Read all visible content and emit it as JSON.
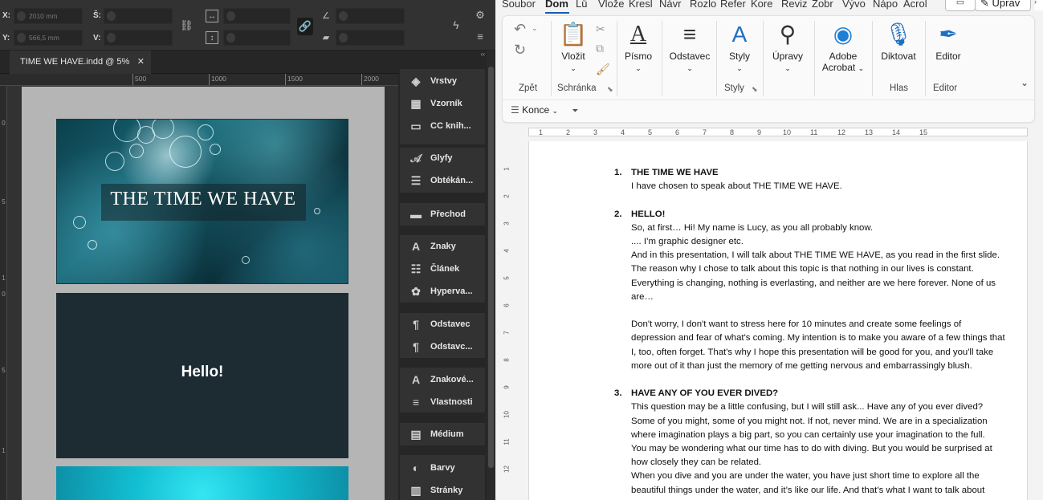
{
  "indesign": {
    "control": {
      "x_label": "X:",
      "x_value": "2010 mm",
      "y_label": "Y:",
      "y_value": "566,5 mm",
      "w_label": "Š:",
      "w_value": "",
      "h_label": "V:",
      "h_value": ""
    },
    "doc_tab": "TIME WE HAVE.indd @ 5%",
    "doc_tab_close": "✕",
    "ruler_labels": [
      "500",
      "1000",
      "1500",
      "2000"
    ],
    "vruler_labels": [
      "0",
      "5",
      "1",
      "0",
      "5",
      "1"
    ],
    "slide1_title": "THE TIME WE HAVE",
    "slide2_title": "Hello!",
    "collapse_glyph": "‹‹",
    "panels": [
      {
        "label": "Vrstvy",
        "icon": "layers-icon",
        "glyph": "◈"
      },
      {
        "label": "Vzorník",
        "icon": "swatches-icon",
        "glyph": "▦"
      },
      {
        "label": "CC knih...",
        "icon": "cc-libraries-icon",
        "glyph": "▭"
      },
      {
        "label": "Glyfy",
        "icon": "glyphs-icon",
        "glyph": "𝒜"
      },
      {
        "label": "Obtékán...",
        "icon": "text-wrap-icon",
        "glyph": "☰"
      },
      {
        "label": "Přechod",
        "icon": "gradient-icon",
        "glyph": "▬"
      },
      {
        "label": "Znaky",
        "icon": "character-icon",
        "glyph": "A"
      },
      {
        "label": "Článek",
        "icon": "article-icon",
        "glyph": "☷"
      },
      {
        "label": "Hyperva...",
        "icon": "hyperlinks-icon",
        "glyph": "✿"
      },
      {
        "label": "Odstavec",
        "icon": "paragraph-icon",
        "glyph": "¶"
      },
      {
        "label": "Odstavc...",
        "icon": "paragraph-styles-icon",
        "glyph": "¶"
      },
      {
        "label": "Znakové...",
        "icon": "character-styles-icon",
        "glyph": "A"
      },
      {
        "label": "Vlastnosti",
        "icon": "properties-icon",
        "glyph": "≡"
      },
      {
        "label": "Médium",
        "icon": "media-icon",
        "glyph": "▤"
      },
      {
        "label": "Barvy",
        "icon": "color-icon",
        "glyph": "◐"
      },
      {
        "label": "Stránky",
        "icon": "pages-icon",
        "glyph": "▥"
      }
    ]
  },
  "word": {
    "tabs": [
      "Soubor",
      "Dom",
      "Lů",
      "Vlože",
      "Kresl",
      "Návr",
      "Rozlo",
      "Refer",
      "Kore",
      "Reviz",
      "Zobr",
      "Vývo",
      "Nápo",
      "Acrol"
    ],
    "share_label": "Úprav",
    "ribbon": {
      "undo_label": "Zpět",
      "paste_label": "Vložit",
      "clipboard_label": "Schránka",
      "font_label": "Písmo",
      "paragraph_label": "Odstavec",
      "styles_label": "Styly",
      "styles_group": "Styly",
      "editing_label": "Úpravy",
      "acrobat_label_1": "Adobe",
      "acrobat_label_2": "Acrobat",
      "dictate_label": "Diktovat",
      "voice_group": "Hlas",
      "editor_label": "Editor",
      "editor_group": "Editor",
      "style_box": "Konce"
    },
    "ruler_labels": [
      "1",
      "2",
      "3",
      "4",
      "5",
      "6",
      "7",
      "8",
      "9",
      "10",
      "11",
      "12",
      "13",
      "14",
      "15"
    ],
    "vruler_labels": [
      "1",
      "2",
      "3",
      "4",
      "5",
      "6",
      "7",
      "8",
      "9",
      "10",
      "11",
      "12"
    ],
    "items": [
      {
        "num": "1.",
        "title": "THE TIME WE HAVE",
        "lines": [
          "I have chosen to speak about THE TIME WE HAVE."
        ]
      },
      {
        "num": "2.",
        "title": "HELLO!",
        "lines": [
          "So, at first… Hi! My name is Lucy, as you all probably know.",
          ".... I’m graphic designer etc.",
          "And in this presentation, I will talk about THE TIME WE HAVE, as you read in the first slide.",
          "The reason why I chose to talk about this topic is that nothing in our lives is constant.",
          "Everything is changing, nothing is everlasting, and neither are we here forever. None of us",
          "are…",
          "",
          "Don't worry, I don't want to stress here for 10 minutes and create some feelings of",
          "depression and fear of what's coming. My intention is to make you aware of a few things that",
          "I, too, often forget. That's why I hope this presentation will be good for you, and you'll take",
          "more out of it than just the memory of me getting nervous and embarrassingly blush."
        ]
      },
      {
        "num": "3.",
        "title": "HAVE ANY OF YOU EVER DIVED?",
        "lines": [
          "This question may be a little confusing, but I will still ask... Have any of you ever dived?",
          "Some of you might, some of you might not. If not, never mind. We are in a specialization",
          "where imagination plays a big part, so you can certainly use your imagination to the full.",
          "You may be wondering what our time has to do with diving. But you would be surprised at",
          "how closely they can be related.",
          "When you dive and you are under the water, you have just short time to explore all the",
          "beautiful things under the water, and it’s like our life. And that’s what I want to talk about"
        ]
      }
    ]
  }
}
